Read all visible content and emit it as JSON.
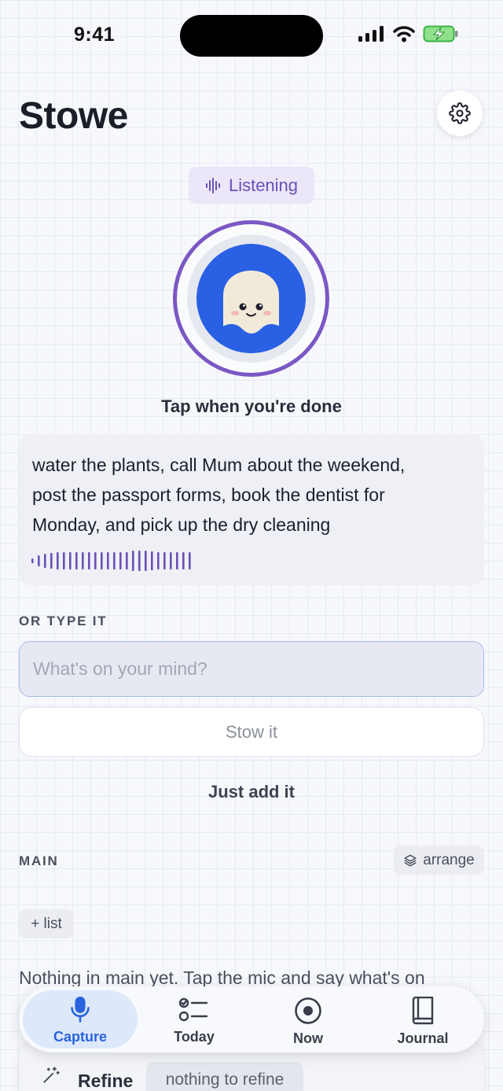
{
  "status_bar": {
    "time": "9:41"
  },
  "header": {
    "title": "Stowe",
    "settings_icon": "gear-icon"
  },
  "listening": {
    "label": "Listening",
    "accent": "#6b50b8"
  },
  "mic": {
    "hint": "Tap when you're done",
    "ring_color": "#7a58c4",
    "core_color": "#2a60e4"
  },
  "transcript": {
    "lines": [
      "water the plants, call Mum about the weekend,",
      "post the passport forms, book the dentist for",
      "Monday, and pick up the dry cleaning"
    ]
  },
  "type_section": {
    "label": "OR TYPE IT",
    "placeholder": "What's on your mind?",
    "stow_label": "Stow it",
    "just_add_label": "Just add it"
  },
  "main_section": {
    "label": "MAIN",
    "arrange_label": "arrange",
    "add_list_label": "+ list",
    "empty_message": "Nothing in main yet. Tap the mic and say what's on"
  },
  "refine": {
    "label": "Refine",
    "chip": "nothing to refine"
  },
  "tabs": [
    {
      "label": "Capture",
      "icon": "mic-icon",
      "active": true
    },
    {
      "label": "Today",
      "icon": "checklist-icon",
      "active": false
    },
    {
      "label": "Now",
      "icon": "target-icon",
      "active": false
    },
    {
      "label": "Journal",
      "icon": "book-icon",
      "active": false
    }
  ]
}
